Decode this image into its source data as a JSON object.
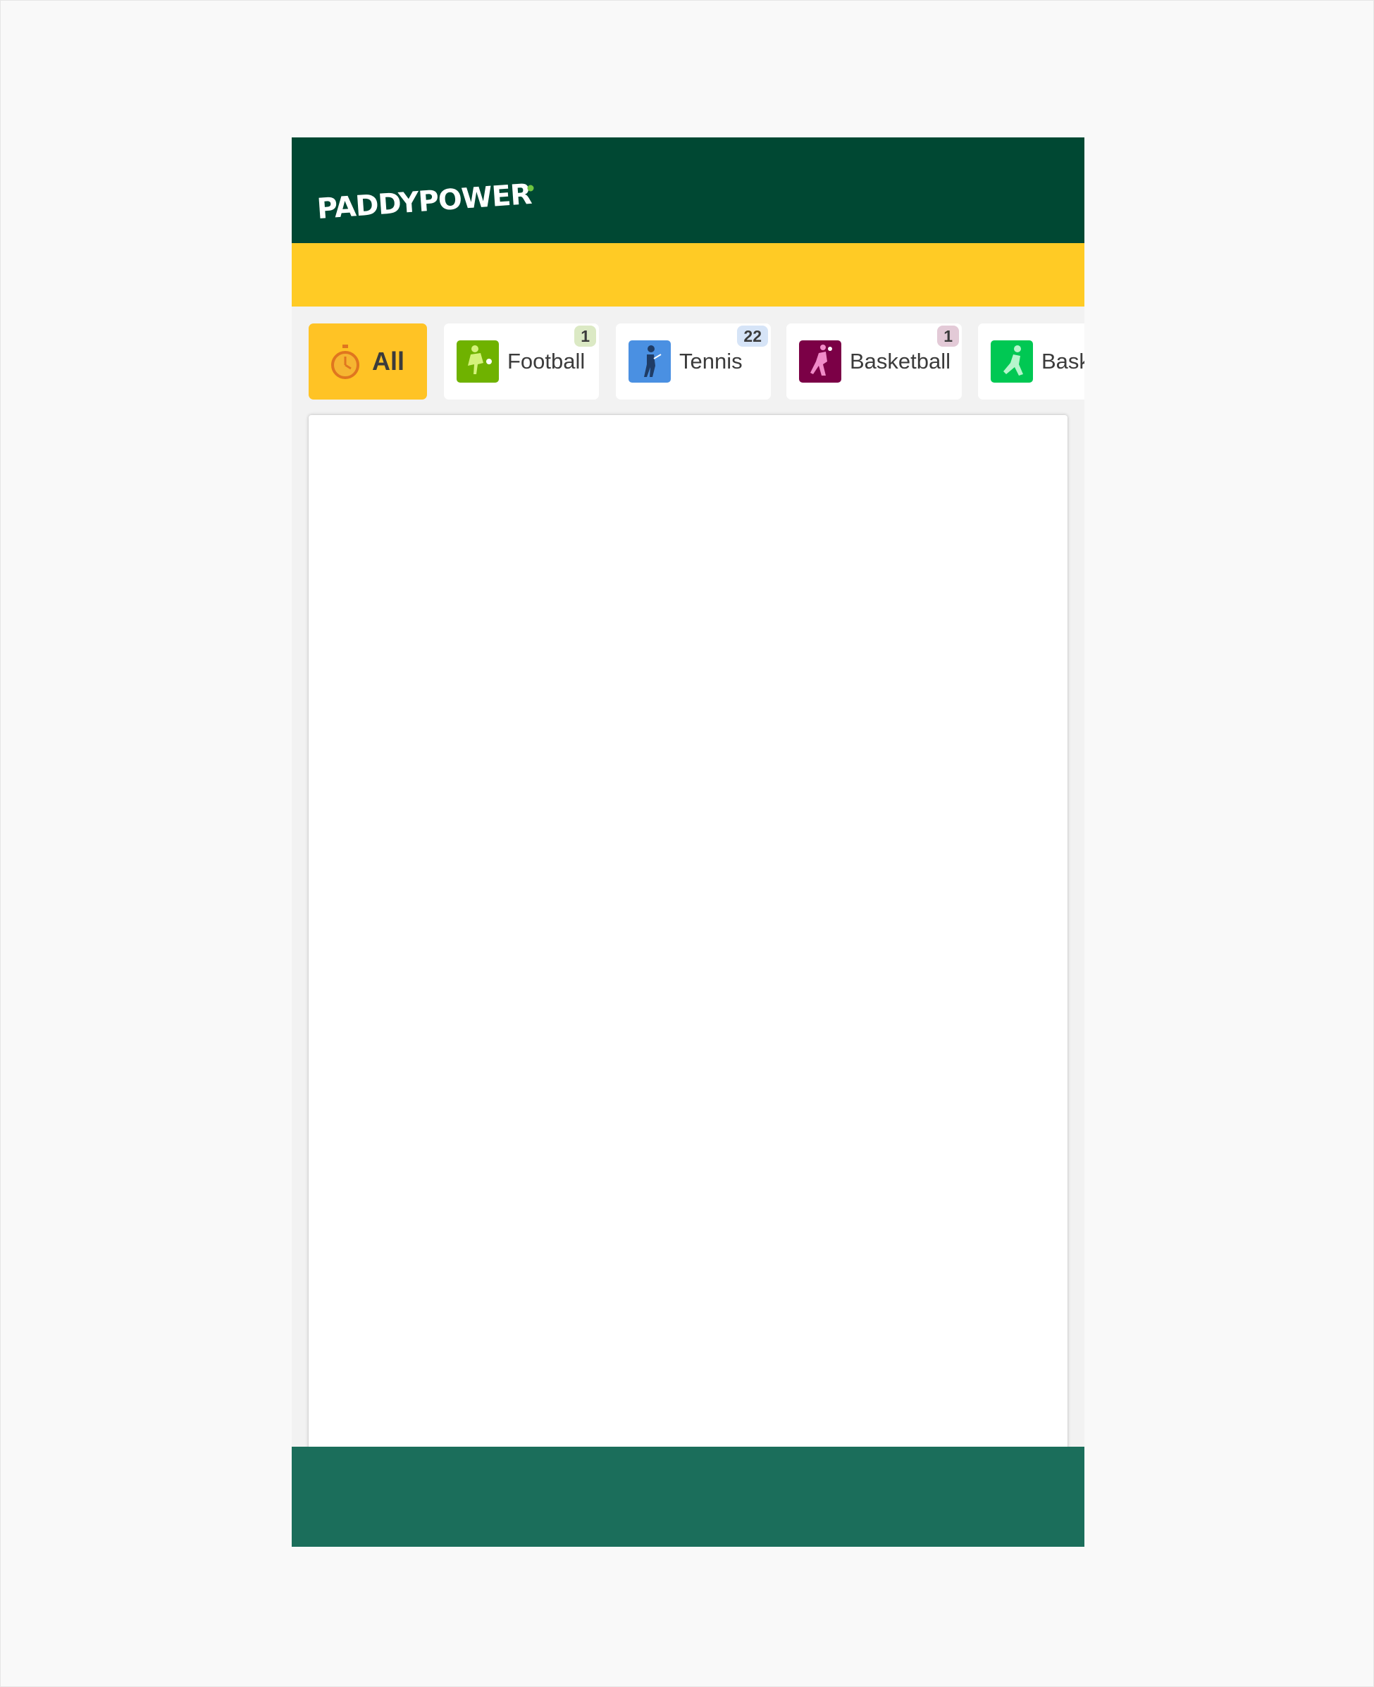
{
  "brand": {
    "name": "PADDYPOWER",
    "header_color": "#004833",
    "promo_bar_color": "#ffcb25",
    "footer_color": "#1b6e5b",
    "logo_dot_color": "#6ec540"
  },
  "sports_tabs": [
    {
      "label": "All",
      "icon": "stopwatch-icon",
      "selected": true,
      "badge": null
    },
    {
      "label": "Football",
      "icon": "football-icon",
      "icon_bg": "#6fb200",
      "badge": "1",
      "badge_bg": "#dbe9c4"
    },
    {
      "label": "Tennis",
      "icon": "tennis-icon",
      "icon_bg": "#4a90e2",
      "badge": "22",
      "badge_bg": "#d6e4f7"
    },
    {
      "label": "Basketball",
      "icon": "basketball-icon",
      "icon_bg": "#7b0046",
      "badge": "1",
      "badge_bg": "#e3cad7"
    },
    {
      "label": "Basketball",
      "icon": "basketball-green-icon",
      "icon_bg": "#00c853",
      "badge": null
    }
  ]
}
